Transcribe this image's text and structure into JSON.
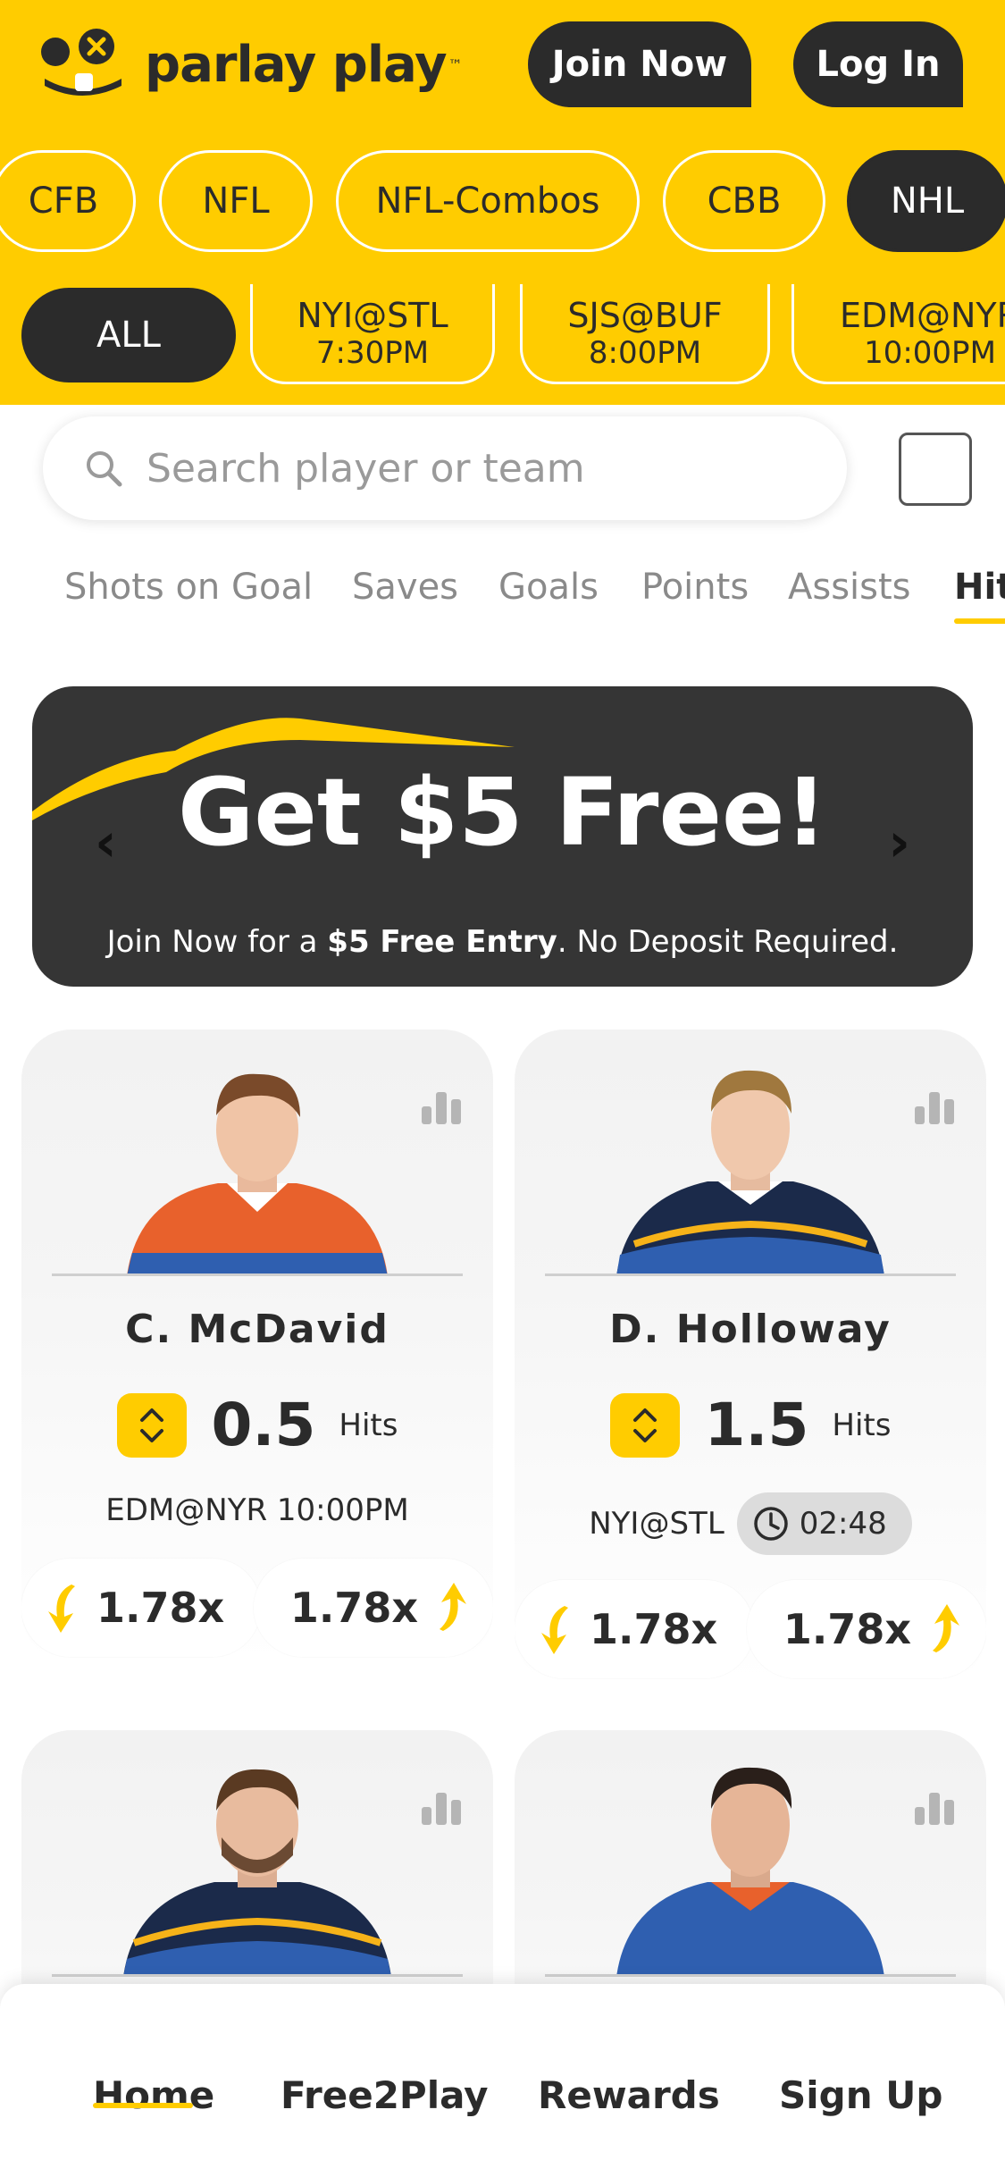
{
  "header": {
    "logo_text": "parlay play",
    "logo_tm": "™",
    "join_label": "Join Now",
    "login_label": "Log In",
    "brand_color": "#FFCC00",
    "dark_color": "#2B2B2B"
  },
  "sports": [
    "CFB",
    "NFL",
    "NFL-Combos",
    "CBB",
    "NHL"
  ],
  "selected_sport": "NHL",
  "games": {
    "all_label": "ALL",
    "items": [
      {
        "teams": "NYI@STL",
        "time": "7:30PM"
      },
      {
        "teams": "SJS@BUF",
        "time": "8:00PM"
      },
      {
        "teams": "EDM@NYR",
        "time": "10:00PM"
      }
    ]
  },
  "search": {
    "placeholder": "Search player or team"
  },
  "stat_tabs": [
    "Shots on Goal",
    "Saves",
    "Goals",
    "Points",
    "Assists",
    "Hits"
  ],
  "selected_stat": "Hits",
  "banner": {
    "title": "Get $5 Free!",
    "sub_pre": "Join Now for a ",
    "sub_bold": "$5 Free Entry",
    "sub_post": ". No Deposit Required.",
    "prev_icon": "chevron-left-icon",
    "next_icon": "chevron-right-icon"
  },
  "cards": [
    {
      "name": "C. McDavid",
      "line": "0.5",
      "stat": "Hits",
      "game": "EDM@NYR 10:00PM",
      "clock": null,
      "less_odds": "1.78x",
      "more_odds": "1.78x",
      "jersey": "#E8612C"
    },
    {
      "name": "D. Holloway",
      "line": "1.5",
      "stat": "Hits",
      "game": "NYI@STL",
      "clock": "02:48",
      "less_odds": "1.78x",
      "more_odds": "1.78x",
      "jersey": "#1B2A4A"
    }
  ],
  "nav": [
    "Home",
    "Free2Play",
    "Rewards",
    "Sign Up"
  ],
  "selected_nav": "Home"
}
